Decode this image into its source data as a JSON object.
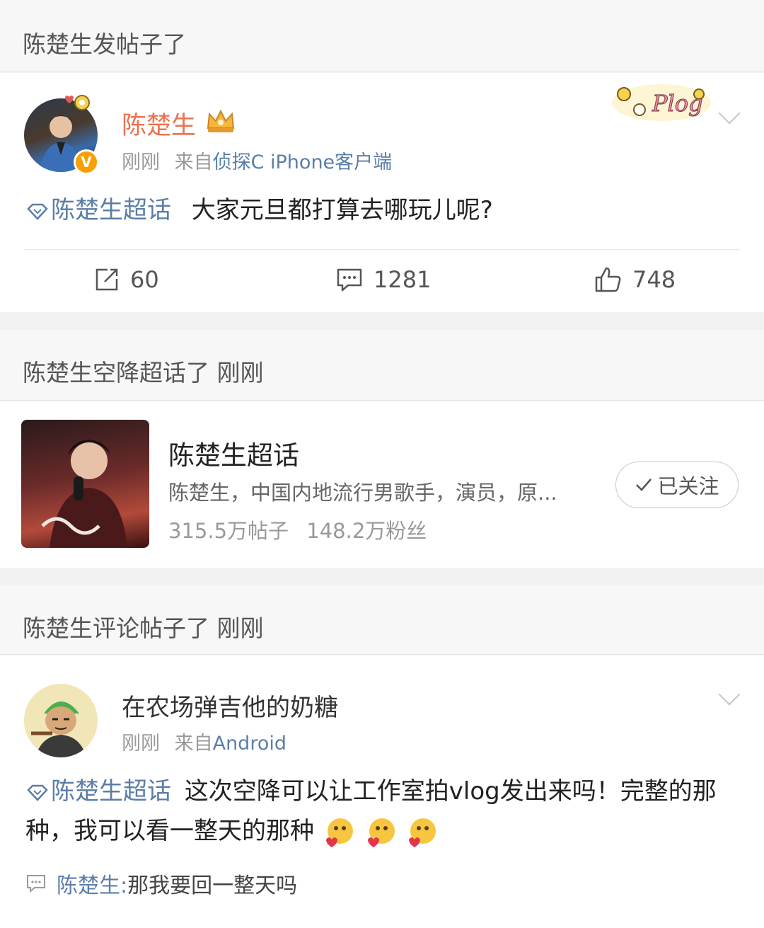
{
  "section1": {
    "header": "陈楚生发帖子了"
  },
  "post": {
    "username": "陈楚生",
    "time": "刚刚",
    "source_prefix": "来自",
    "source": "侦探C iPhone客户端",
    "topic": "陈楚生超话",
    "text": "大家元旦都打算去哪玩儿呢?",
    "sticker_text": "Plog",
    "actions": {
      "repost": "60",
      "comment": "1281",
      "like": "748"
    }
  },
  "section2": {
    "header": "陈楚生空降超话了 刚刚"
  },
  "supertopic": {
    "name": "陈楚生超话",
    "desc": "陈楚生，中国内地流行男歌手，演员，原...",
    "posts": "315.5万帖子",
    "fans": "148.2万粉丝",
    "follow_label": "已关注"
  },
  "section3": {
    "header": "陈楚生评论帖子了 刚刚"
  },
  "comment_post": {
    "username": "在农场弹吉他的奶糖",
    "time": "刚刚",
    "source_prefix": "来自",
    "source": "Android",
    "topic": "陈楚生超话",
    "text": "这次空降可以让工作室拍vlog发出来吗！完整的那种，我可以看一整天的那种",
    "reply_name": "陈楚生:",
    "reply_text": "那我要回一整天吗"
  },
  "colors": {
    "username_orange": "#eb7350",
    "link_blue": "#5b7ea8",
    "vip_gold": "#f7a000"
  }
}
